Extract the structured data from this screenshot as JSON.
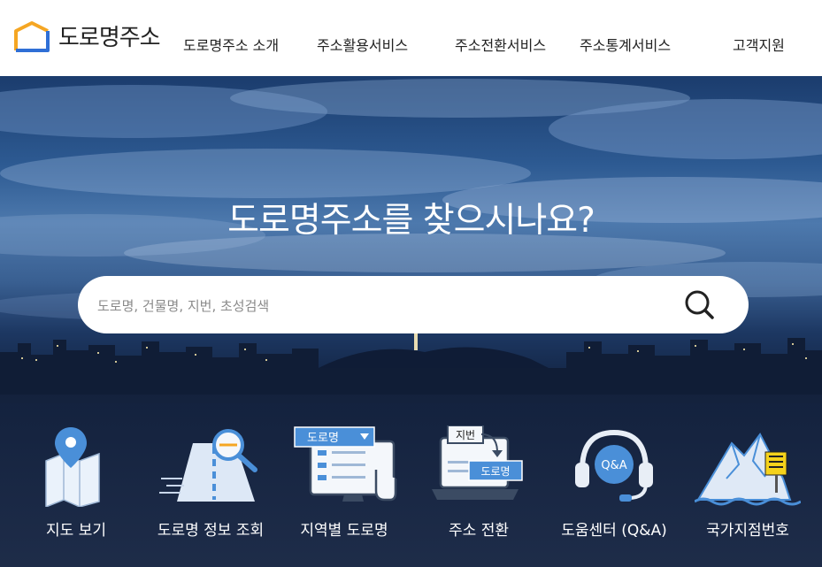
{
  "header": {
    "logo_text": "도로명주소",
    "nav": [
      {
        "label": "도로명주소 소개"
      },
      {
        "label": "주소활용서비스"
      },
      {
        "label": "주소전환서비스"
      },
      {
        "label": "주소통계서비스"
      },
      {
        "label": "고객지원"
      }
    ]
  },
  "hero": {
    "title": "도로명주소를 찾으시나요?",
    "search_placeholder": "도로명, 건물명, 지번, 초성검색"
  },
  "services": [
    {
      "label": "지도 보기",
      "icon": "map-icon"
    },
    {
      "label": "도로명 정보 조회",
      "icon": "road-search-icon"
    },
    {
      "label": "지역별 도로명",
      "icon": "region-road-icon",
      "badge": "도로명"
    },
    {
      "label": "주소 전환",
      "icon": "address-convert-icon",
      "badge_top": "지번",
      "badge_bottom": "도로명"
    },
    {
      "label": "도움센터 (Q&A)",
      "icon": "help-center-icon",
      "badge": "Q&A"
    },
    {
      "label": "국가지점번호",
      "icon": "national-point-icon"
    }
  ],
  "colors": {
    "accent": "#f5a623",
    "logo_blue": "#2f6fd6",
    "icon_blue": "#4a8fd8"
  }
}
